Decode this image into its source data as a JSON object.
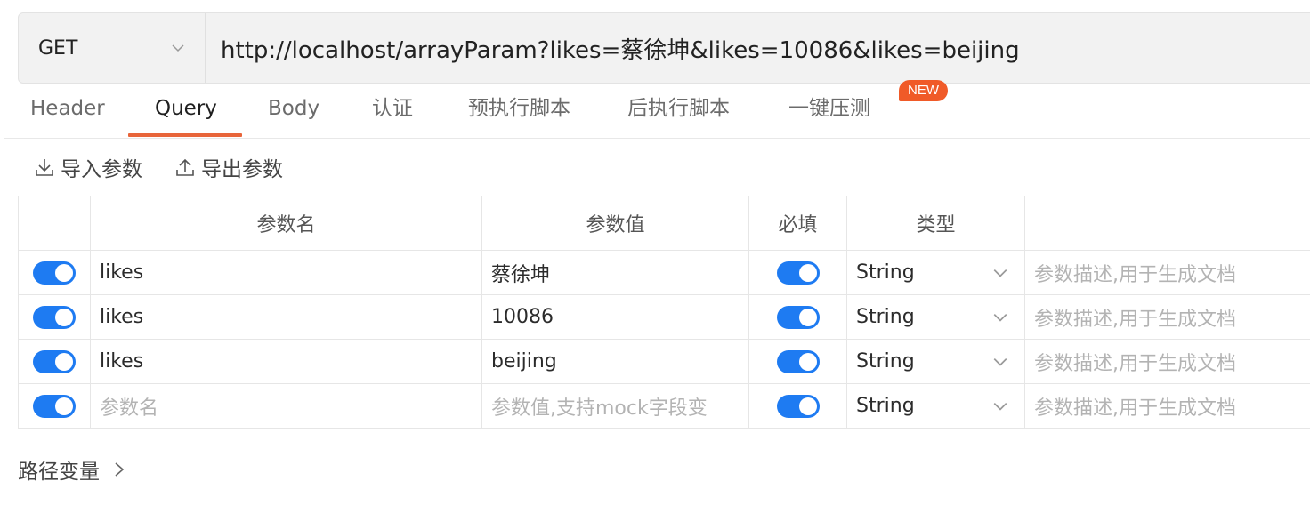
{
  "request": {
    "method": "GET",
    "url": "http://localhost/arrayParam?likes=蔡徐坤&likes=10086&likes=beijing"
  },
  "tabs": [
    {
      "label": "Header",
      "active": false
    },
    {
      "label": "Query",
      "active": true
    },
    {
      "label": "Body",
      "active": false
    },
    {
      "label": "认证",
      "active": false
    },
    {
      "label": "预执行脚本",
      "active": false
    },
    {
      "label": "后执行脚本",
      "active": false
    },
    {
      "label": "一键压测",
      "active": false
    }
  ],
  "new_badge": "NEW",
  "toolbar": {
    "import_label": "导入参数",
    "export_label": "导出参数"
  },
  "table": {
    "headers": [
      "",
      "参数名",
      "参数值",
      "必填",
      "类型",
      ""
    ],
    "rows": [
      {
        "enabled": true,
        "name": "likes",
        "value": "蔡徐坤",
        "required": true,
        "type": "String",
        "desc_placeholder": "参数描述,用于生成文档"
      },
      {
        "enabled": true,
        "name": "likes",
        "value": "10086",
        "required": true,
        "type": "String",
        "desc_placeholder": "参数描述,用于生成文档"
      },
      {
        "enabled": true,
        "name": "likes",
        "value": "beijing",
        "required": true,
        "type": "String",
        "desc_placeholder": "参数描述,用于生成文档"
      }
    ],
    "new_row": {
      "enabled": true,
      "name_placeholder": "参数名",
      "value_placeholder": "参数值,支持mock字段变",
      "required": true,
      "type": "String",
      "desc_placeholder": "参数描述,用于生成文档"
    }
  },
  "path_variables_label": "路径变量",
  "colors": {
    "accent": "#1e7bf2",
    "tab_underline": "#e8653a",
    "badge": "#f05a28"
  }
}
